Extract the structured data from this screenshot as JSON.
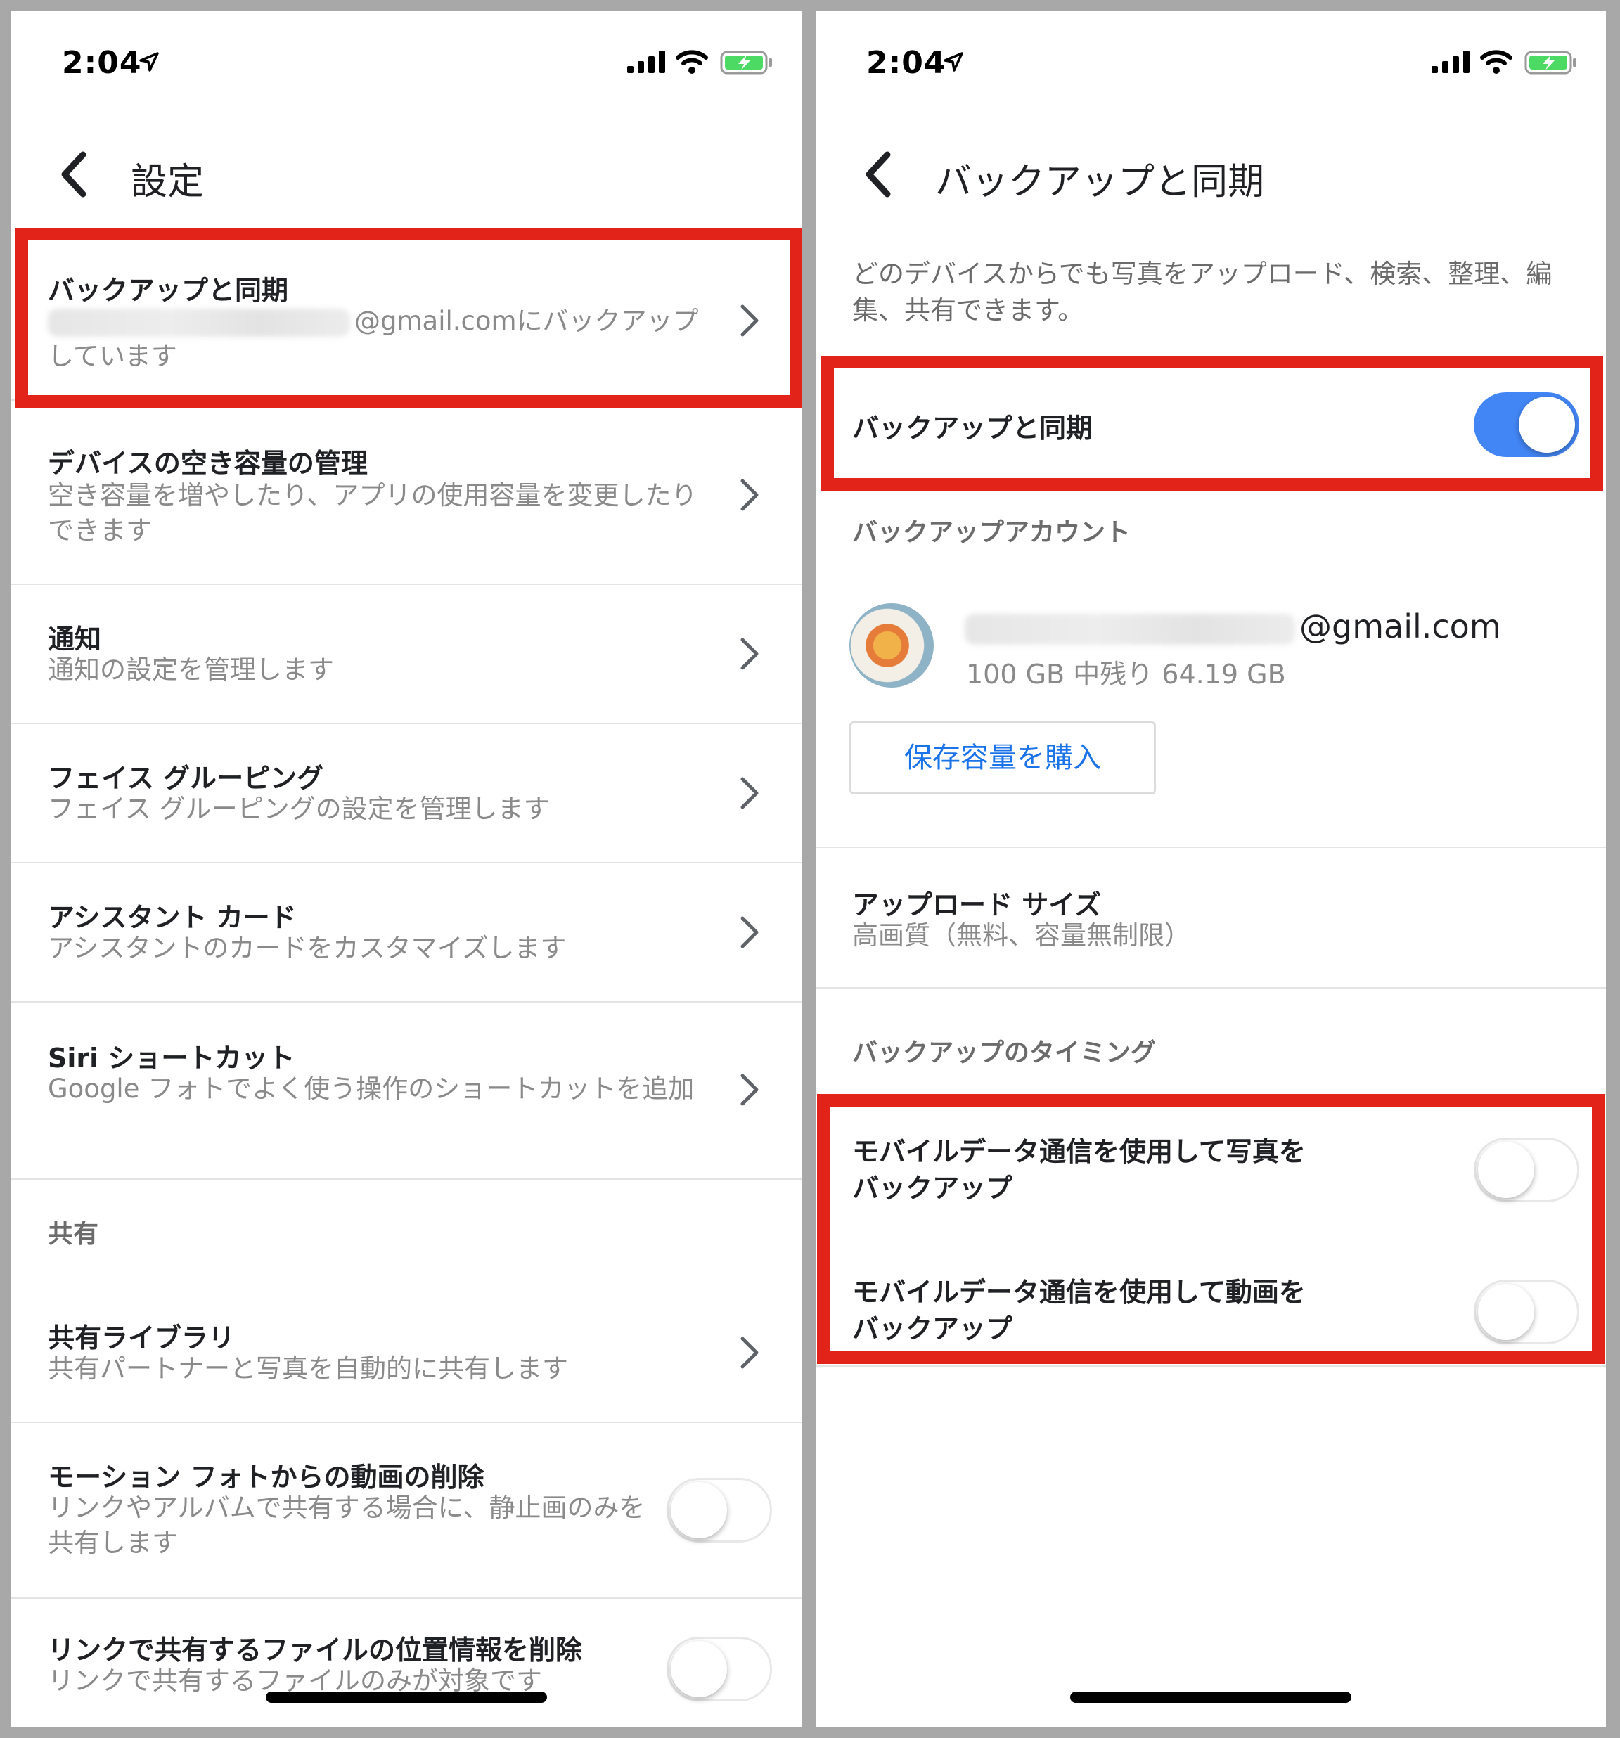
{
  "status_bar": {
    "time": "2:04"
  },
  "left": {
    "header_title": "設定",
    "rows": [
      {
        "title": "バックアップと同期",
        "sub_email": "@gmail.comにバックアップ",
        "sub_rest": "しています"
      },
      {
        "title": "デバイスの空き容量の管理",
        "sub": "空き容量を増やしたり、アプリの使用容量を変更したりできます"
      },
      {
        "title": "通知",
        "sub": "通知の設定を管理します"
      },
      {
        "title": "フェイス グルーピング",
        "sub": "フェイス グルーピングの設定を管理します"
      },
      {
        "title": "アシスタント カード",
        "sub": "アシスタントのカードをカスタマイズします"
      },
      {
        "title": "Siri ショートカット",
        "sub": "Google フォトでよく使う操作のショートカットを追加"
      }
    ],
    "section_shared": "共有",
    "shared_library": {
      "title": "共有ライブラリ",
      "sub": "共有パートナーと写真を自動的に共有します"
    },
    "motion_photo": {
      "title": "モーション フォトからの動画の削除",
      "sub": "リンクやアルバムで共有する場合に、静止画のみを共有します",
      "toggle_on": false
    },
    "location_remove": {
      "title": "リンクで共有するファイルの位置情報を削除",
      "sub": "リンクで共有するファイルのみが対象です",
      "toggle_on": false
    }
  },
  "right": {
    "header_title": "バックアップと同期",
    "description": "どのデバイスからでも写真をアップロード、検索、整理、編集、共有できます。",
    "backup_sync": {
      "label": "バックアップと同期",
      "toggle_on": true
    },
    "account_section": "バックアップアカウント",
    "account": {
      "email_suffix": "@gmail.com",
      "storage": "100 GB 中残り 64.19 GB"
    },
    "buy_storage": "保存容量を購入",
    "upload_size": {
      "title": "アップロード サイズ",
      "sub": "高画質（無料、容量無制限）"
    },
    "timing_section": "バックアップのタイミング",
    "mobile_photos": {
      "line1": "モバイルデータ通信を使用して写真を",
      "line2": "バックアップ",
      "toggle_on": false
    },
    "mobile_videos": {
      "line1": "モバイルデータ通信を使用して動画を",
      "line2": "バックアップ",
      "toggle_on": false
    }
  },
  "colors": {
    "accent_blue": "#4285f4",
    "highlight_red": "#e2231a",
    "link_blue": "#1a73e8",
    "battery_green": "#4cd964"
  }
}
